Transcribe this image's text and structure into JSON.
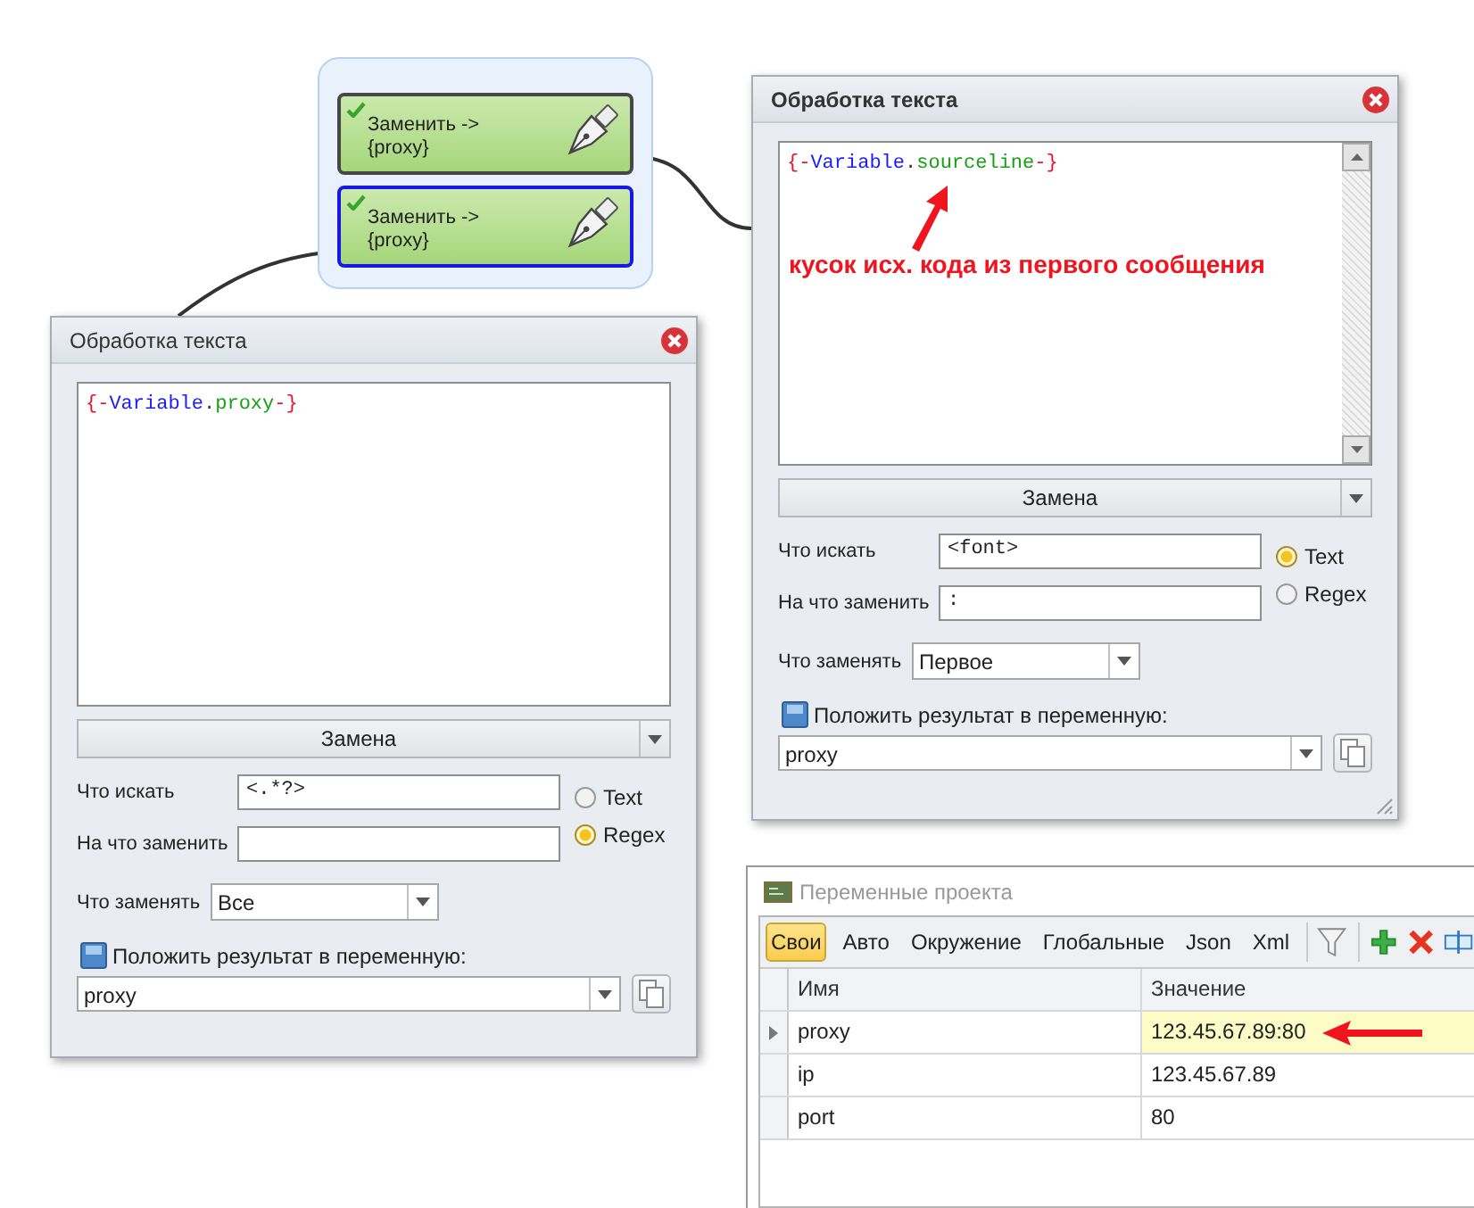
{
  "workflow": {
    "nodes": [
      {
        "title": "Заменить ->",
        "subtitle": "{proxy}",
        "done": true,
        "selected": false
      },
      {
        "title": "Заменить ->",
        "subtitle": "{proxy}",
        "done": true,
        "selected": true
      }
    ]
  },
  "dialogs": [
    {
      "title": "Обработка текста",
      "active": true,
      "scrollbar": true,
      "code": [
        {
          "kind": "brace",
          "text": "{-"
        },
        {
          "kind": "keyword",
          "text": "Variable"
        },
        {
          "kind": "dot",
          "text": "."
        },
        {
          "kind": "name",
          "text": "sourceline"
        },
        {
          "kind": "brace",
          "text": "-}"
        }
      ],
      "annotation": "кусок исх. кода из первого сообщения",
      "action": "Замена",
      "find_label": "Что искать",
      "find_value": "<font>",
      "replace_label": "На что заменить",
      "replace_value": ":",
      "modes": [
        {
          "label": "Text",
          "selected": true
        },
        {
          "label": "Regex",
          "selected": false
        }
      ],
      "scope_label": "Что заменять",
      "scope_value": "Первое",
      "save_label": "Положить результат в переменную:",
      "variable": "proxy"
    },
    {
      "title": "Обработка текста",
      "active": false,
      "scrollbar": false,
      "code": [
        {
          "kind": "brace",
          "text": "{-"
        },
        {
          "kind": "keyword",
          "text": "Variable"
        },
        {
          "kind": "dot",
          "text": "."
        },
        {
          "kind": "name",
          "text": "proxy"
        },
        {
          "kind": "brace",
          "text": "-}"
        }
      ],
      "action": "Замена",
      "find_label": "Что искать",
      "find_value": "<.*?>",
      "replace_label": "На что заменить",
      "modes": [
        {
          "label": "Text",
          "selected": false
        },
        {
          "label": "Regex",
          "selected": true
        }
      ],
      "scope_label": "Что заменять",
      "scope_value": "Все",
      "save_label": "Положить результат в переменную:",
      "variable": "proxy"
    }
  ],
  "variables": {
    "title": "Переменные проекта",
    "tabs": [
      {
        "label": "Свои",
        "selected": true
      },
      {
        "label": "Авто",
        "selected": false
      },
      {
        "label": "Окружение",
        "selected": false
      },
      {
        "label": "Глобальные",
        "selected": false
      },
      {
        "label": "Json",
        "selected": false
      },
      {
        "label": "Xml",
        "selected": false
      }
    ],
    "columns": [
      "Имя",
      "Значение"
    ],
    "rows": [
      {
        "name": "proxy",
        "value": "123.45.67.89:80",
        "selected": true
      },
      {
        "name": "ip",
        "value": "123.45.67.89",
        "selected": false
      },
      {
        "name": "port",
        "value": "80",
        "selected": false
      }
    ]
  }
}
